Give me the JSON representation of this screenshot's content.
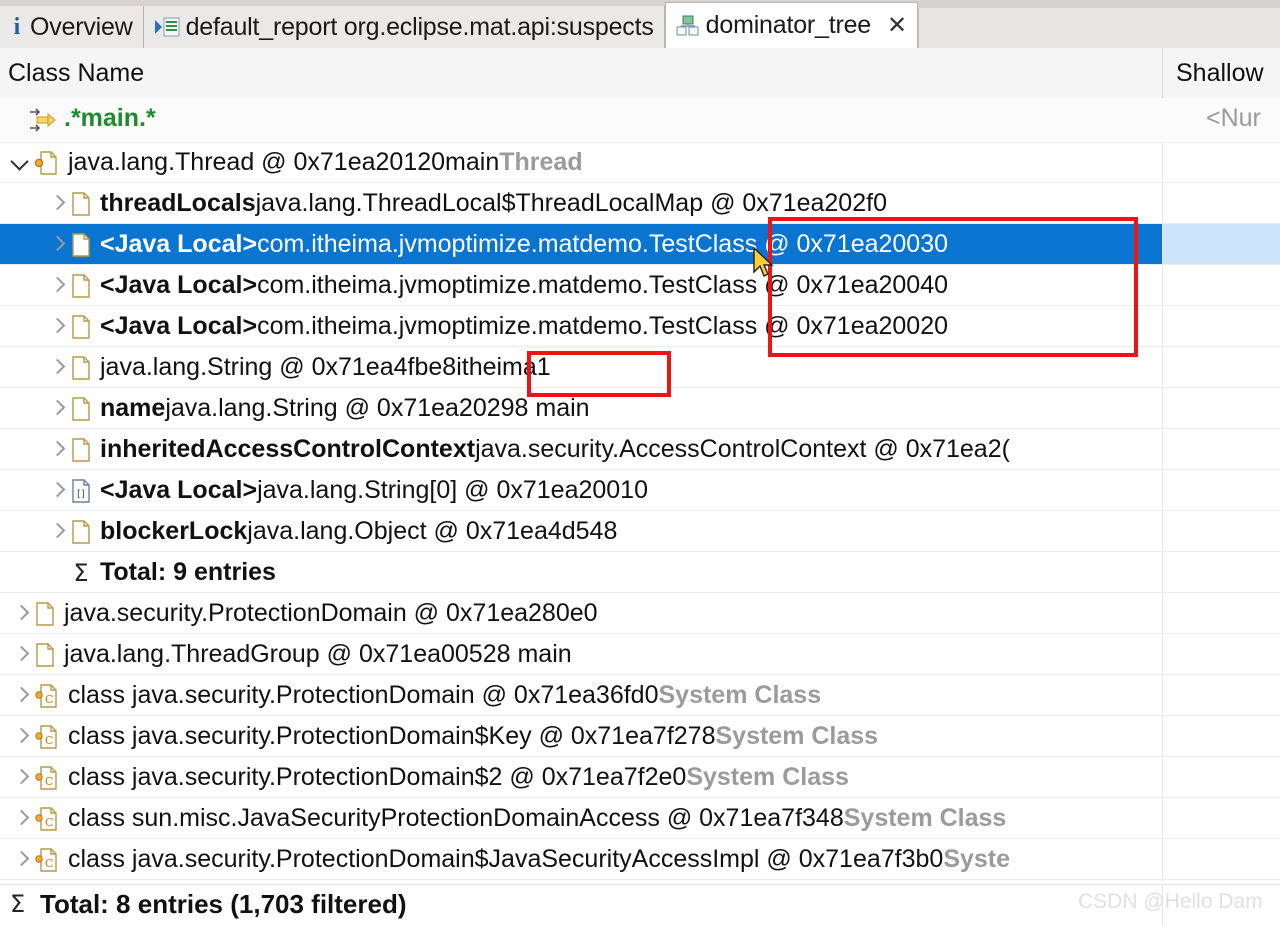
{
  "tabs": [
    {
      "label": "Overview",
      "icon": "info-icon",
      "active": false,
      "closable": false
    },
    {
      "label": "default_report org.eclipse.mat.api:suspects",
      "icon": "report-icon",
      "active": false,
      "closable": false
    },
    {
      "label": "dominator_tree",
      "icon": "dominator-tree-icon",
      "active": true,
      "closable": true,
      "close_glyph": "✕"
    }
  ],
  "columns": {
    "class_name": "Class Name",
    "shallow": "Shallow",
    "shallow_filter": "<Nur"
  },
  "filter": {
    "pattern": ".*main.*",
    "icon": "filter-icon"
  },
  "rows": [
    {
      "indent": 8,
      "twisty": "down",
      "icon": "thread-icon",
      "parts": [
        {
          "text": "java.lang.Thread @ 0x71ea20120",
          "style": "normal"
        },
        {
          "text": "  main ",
          "style": "normal"
        },
        {
          "text": "Thread",
          "style": "muted"
        }
      ],
      "selected": false
    },
    {
      "indent": 44,
      "twisty": "right",
      "icon": "object-icon",
      "parts": [
        {
          "text": "threadLocals",
          "style": "bold"
        },
        {
          "text": " java.lang.ThreadLocal$ThreadLocalMap @ 0x71ea202f0",
          "style": "normal"
        }
      ],
      "selected": false
    },
    {
      "indent": 44,
      "twisty": "right",
      "icon": "object-icon",
      "parts": [
        {
          "text": "<Java Local>",
          "style": "bold"
        },
        {
          "text": " com.itheima.jvmoptimize.matdemo.TestClass @ 0x71ea20030",
          "style": "normal"
        }
      ],
      "selected": true
    },
    {
      "indent": 44,
      "twisty": "right",
      "icon": "object-icon",
      "parts": [
        {
          "text": "<Java Local>",
          "style": "bold"
        },
        {
          "text": " com.itheima.jvmoptimize.matdemo.TestClass @ 0x71ea20040",
          "style": "normal"
        }
      ],
      "selected": false
    },
    {
      "indent": 44,
      "twisty": "right",
      "icon": "object-icon",
      "parts": [
        {
          "text": "<Java Local>",
          "style": "bold"
        },
        {
          "text": " com.itheima.jvmoptimize.matdemo.TestClass @ 0x71ea20020",
          "style": "normal"
        }
      ],
      "selected": false
    },
    {
      "indent": 44,
      "twisty": "right",
      "icon": "object-icon",
      "parts": [
        {
          "text": "java.lang.String @ 0x71ea4fbe8",
          "style": "normal"
        },
        {
          "text": "  itheima1",
          "style": "normal"
        }
      ],
      "selected": false
    },
    {
      "indent": 44,
      "twisty": "right",
      "icon": "object-icon",
      "parts": [
        {
          "text": "name",
          "style": "bold"
        },
        {
          "text": " java.lang.String @ 0x71ea20298  main",
          "style": "normal"
        }
      ],
      "selected": false
    },
    {
      "indent": 44,
      "twisty": "right",
      "icon": "object-icon",
      "parts": [
        {
          "text": "inheritedAccessControlContext",
          "style": "bold"
        },
        {
          "text": " java.security.AccessControlContext @ 0x71ea2(",
          "style": "normal"
        }
      ],
      "selected": false
    },
    {
      "indent": 44,
      "twisty": "right",
      "icon": "array-icon",
      "parts": [
        {
          "text": "<Java Local>",
          "style": "bold"
        },
        {
          "text": " java.lang.String[0] @ 0x71ea20010",
          "style": "normal"
        }
      ],
      "selected": false
    },
    {
      "indent": 44,
      "twisty": "right",
      "icon": "object-icon",
      "parts": [
        {
          "text": "blockerLock",
          "style": "bold"
        },
        {
          "text": " java.lang.Object @ 0x71ea4d548",
          "style": "normal"
        }
      ],
      "selected": false
    },
    {
      "indent": 44,
      "twisty": "none",
      "icon": "sigma-icon",
      "parts": [
        {
          "text": "Total: 9 entries",
          "style": "bold"
        }
      ],
      "selected": false
    },
    {
      "indent": 8,
      "twisty": "right",
      "icon": "object-icon",
      "parts": [
        {
          "text": "java.security.ProtectionDomain @ 0x71ea280e0",
          "style": "normal"
        }
      ],
      "selected": false
    },
    {
      "indent": 8,
      "twisty": "right",
      "icon": "object-icon",
      "parts": [
        {
          "text": "java.lang.ThreadGroup @ 0x71ea00528  main",
          "style": "normal"
        }
      ],
      "selected": false
    },
    {
      "indent": 8,
      "twisty": "right",
      "icon": "class-icon",
      "parts": [
        {
          "text": "class java.security.ProtectionDomain @ 0x71ea36fd0 ",
          "style": "normal"
        },
        {
          "text": "System Class",
          "style": "muted"
        }
      ],
      "selected": false
    },
    {
      "indent": 8,
      "twisty": "right",
      "icon": "class-icon",
      "parts": [
        {
          "text": "class java.security.ProtectionDomain$Key @ 0x71ea7f278 ",
          "style": "normal"
        },
        {
          "text": "System Class",
          "style": "muted"
        }
      ],
      "selected": false
    },
    {
      "indent": 8,
      "twisty": "right",
      "icon": "class-icon",
      "parts": [
        {
          "text": "class java.security.ProtectionDomain$2 @ 0x71ea7f2e0 ",
          "style": "normal"
        },
        {
          "text": "System Class",
          "style": "muted"
        }
      ],
      "selected": false
    },
    {
      "indent": 8,
      "twisty": "right",
      "icon": "class-icon",
      "parts": [
        {
          "text": "class sun.misc.JavaSecurityProtectionDomainAccess @ 0x71ea7f348 ",
          "style": "normal"
        },
        {
          "text": "System Class",
          "style": "muted"
        }
      ],
      "selected": false
    },
    {
      "indent": 8,
      "twisty": "right",
      "icon": "class-icon",
      "parts": [
        {
          "text": "class java.security.ProtectionDomain$JavaSecurityAccessImpl @ 0x71ea7f3b0 ",
          "style": "normal"
        },
        {
          "text": "Syste",
          "style": "muted"
        }
      ],
      "selected": false
    }
  ],
  "footer": {
    "sigma": "Σ",
    "total": "Total: 8 entries (1,703 filtered)"
  },
  "annotations": {
    "testclass_box": "red-highlight-box-testclass",
    "itheima_box": "red-highlight-box-itheima1"
  },
  "watermark": "CSDN @Hello Dam",
  "colors": {
    "selection_blue": "#0a75d0",
    "selection_halo": "#cde5fa",
    "annotation_red": "#ef1414",
    "filter_green": "#1f8a2e",
    "muted_gray": "#9b9b9b"
  }
}
